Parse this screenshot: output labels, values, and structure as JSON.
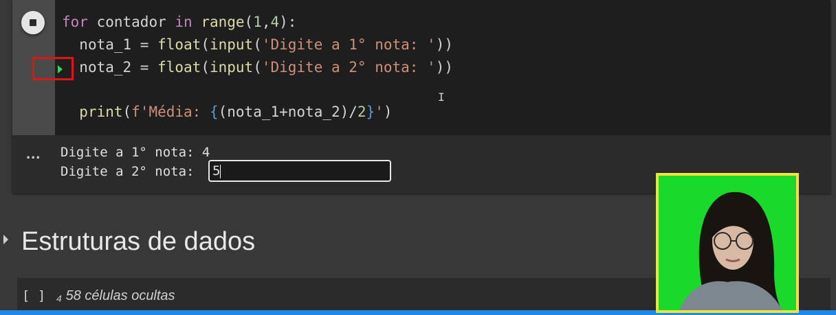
{
  "code_cell": {
    "lines": [
      {
        "kw": "for",
        "var": " contador ",
        "kw2": "in",
        "fn": " range",
        "rest": "(",
        "num1": "1",
        "comma": ",",
        "num2": "4",
        "end": "):"
      },
      {
        "indent": "  ",
        "var": "nota_1 = ",
        "fn": "float",
        "p1": "(",
        "fn2": "input",
        "p2": "(",
        "str": "'Digite a 1° nota: '",
        "end": "))"
      },
      {
        "indent": "  ",
        "var": "nota_2 = ",
        "fn": "float",
        "p1": "(",
        "fn2": "input",
        "p2": "(",
        "str": "'Digite a 2° nota: '",
        "end": "))"
      },
      {
        "indent": "  ",
        "fn": "print",
        "p1": "(",
        "str1": "f'Média: ",
        "brace1": "{",
        "expr": "(nota_1+nota_2)/",
        "num": "2",
        "brace2": "}",
        "str2": "'",
        "end": ")"
      }
    ]
  },
  "output": {
    "dots": "...",
    "line1": "Digite a 1° nota: 4",
    "line2_prompt": "Digite a 2° nota: ",
    "input_value": "5"
  },
  "section": {
    "title": "Estruturas de dados"
  },
  "hidden_cells": {
    "brackets": "[ ]",
    "label": "₄ 58 células ocultas"
  },
  "colors": {
    "accent_bar": "#1e88e5",
    "breakpoint_box": "#e01414",
    "webcam_frame": "#f4e23a"
  },
  "icons": {
    "run_button": "stop-icon",
    "run_arrow": "execution-arrow-icon",
    "section_toggle": "chevron-right-icon"
  }
}
